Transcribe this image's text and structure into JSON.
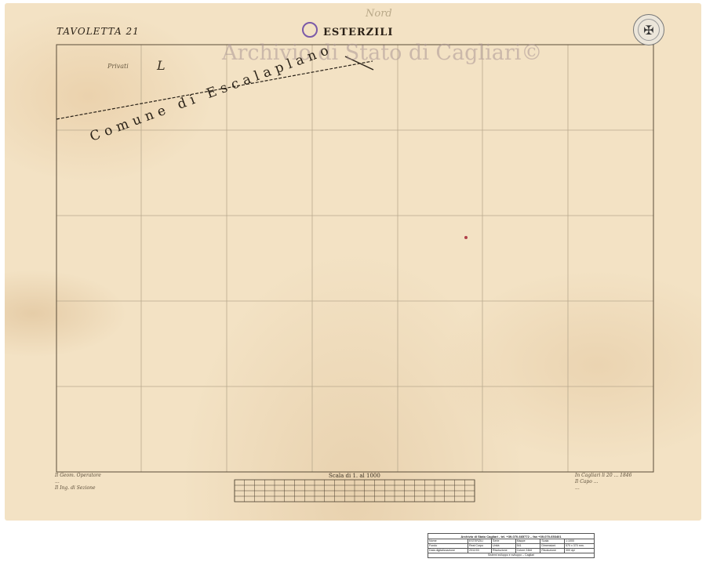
{
  "map": {
    "tavoletta": "TAVOLETTA 21",
    "title": "ESTERZILI",
    "pencil_note": "Nord",
    "watermark": "Archivio di Stato di Cagliari©",
    "commune_label": "Comune di Escalaplano",
    "privati": "Privati",
    "parcel_letter": "L",
    "scale_label": "Scala di 1. al 1000",
    "signature_left": [
      "Il Geom. Operatore",
      "...",
      "Il Ing. di Sezione"
    ],
    "signature_right": [
      "In Cagliari li 20 ... 1846",
      "Il Capo ...",
      "..."
    ]
  },
  "info_table": {
    "header": "Archivio di Stato Cagliari - tel. +39-070-665772 – fax +39-070-653401",
    "rows": [
      [
        "Nome",
        "ESTERZILI",
        "Serie",
        "Mappe",
        "Scala",
        "1:1000"
      ],
      [
        "Fondo",
        "Real Corpo",
        "Unità",
        "541",
        "Dimensioni",
        "570 x 370  mm."
      ],
      [
        "Data digitalizzazione",
        "2011/03",
        "Risoluzione",
        "Colore 24bit",
        "Risoluzione",
        "300 dpi"
      ]
    ],
    "footer": "Sistemi sviluppo e sviluppo – Cagliari"
  },
  "colors": {
    "paper": "#f3e2c4",
    "grid_line": "#b8a98e",
    "ink": "#2a2218",
    "seal_violet": "#7b5aa8"
  }
}
